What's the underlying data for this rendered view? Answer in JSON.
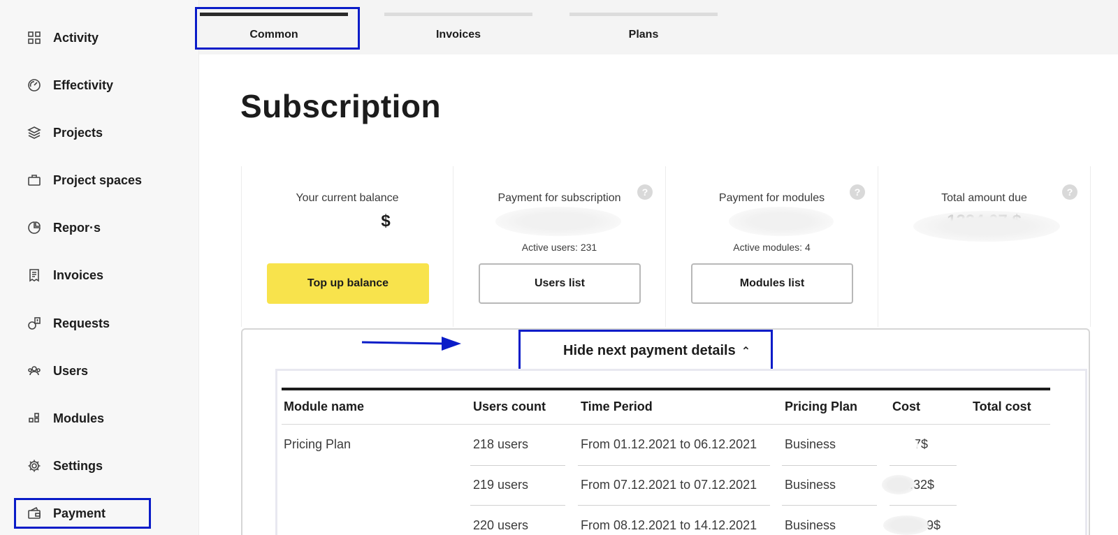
{
  "sidebar": {
    "items": [
      {
        "label": "Activity",
        "icon": "grid-icon"
      },
      {
        "label": "Effectivity",
        "icon": "gauge-icon"
      },
      {
        "label": "Projects",
        "icon": "layers-icon"
      },
      {
        "label": "Project spaces",
        "icon": "briefcase-icon"
      },
      {
        "label": "Repor·s",
        "icon": "pie-chart-icon"
      },
      {
        "label": "Invoices",
        "icon": "receipt-icon"
      },
      {
        "label": "Requests",
        "icon": "request-icon"
      },
      {
        "label": "Users",
        "icon": "users-icon"
      },
      {
        "label": "Modules",
        "icon": "modules-icon"
      },
      {
        "label": "Settings",
        "icon": "gear-icon"
      },
      {
        "label": "Payment",
        "icon": "wallet-icon"
      }
    ]
  },
  "tabs": [
    {
      "label": "Common",
      "active": true
    },
    {
      "label": "Invoices",
      "active": false
    },
    {
      "label": "Plans",
      "active": false
    }
  ],
  "page": {
    "title": "Subscription"
  },
  "cards": [
    {
      "title": "Your current balance",
      "value": "$",
      "sub": "",
      "button": "Top up balance",
      "help": false
    },
    {
      "title": "Payment for subscription",
      "value": "",
      "sub": "Active users: 231",
      "button": "Users list",
      "help": true
    },
    {
      "title": "Payment for modules",
      "value": "",
      "sub": "Active modules: 4",
      "button": "Modules list",
      "help": true
    },
    {
      "title": "Total amount due",
      "value": "1324.07 $",
      "sub": "",
      "button": "",
      "help": true
    }
  ],
  "details": {
    "toggle_label": "Hide next payment details",
    "columns": [
      "Module name",
      "Users count",
      "Time Period",
      "Pricing Plan",
      "Cost",
      "Total cost"
    ],
    "rows": [
      {
        "module": "Pricing Plan",
        "users": "218 users",
        "period": "From 01.12.2021 to 06.12.2021",
        "plan": "Business",
        "cost": "7$"
      },
      {
        "module": "",
        "users": "219 users",
        "period": "From 07.12.2021 to 07.12.2021",
        "plan": "Business",
        "cost": ".32$"
      },
      {
        "module": "",
        "users": "220 users",
        "period": "From 08.12.2021 to 14.12.2021",
        "plan": "Business",
        "cost": "9$"
      }
    ]
  },
  "colors": {
    "accent_annotation": "#0a1cc8",
    "button_yellow": "#f8e34c"
  }
}
